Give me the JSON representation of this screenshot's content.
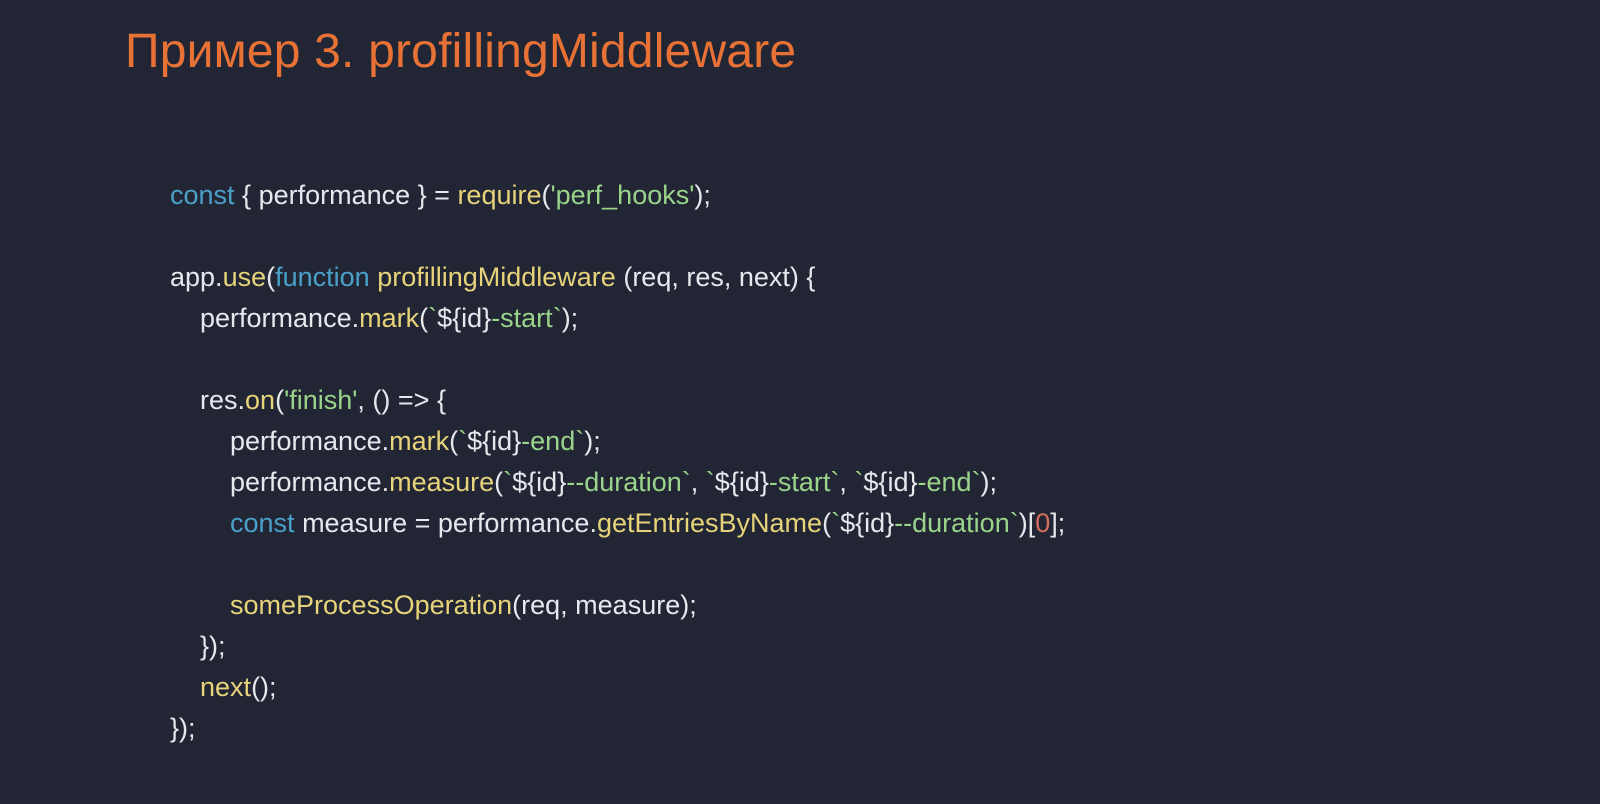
{
  "title": "Пример 3. profillingMiddleware",
  "code": {
    "l1": {
      "kw1": "const",
      "t1": " { performance } = ",
      "fn1": "require",
      "t2": "(",
      "s1": "'perf_hooks'",
      "t3": ");"
    },
    "l2": "",
    "l3": {
      "t1": "app.",
      "fn1": "use",
      "t2": "(",
      "kw1": "function",
      "t3": " ",
      "fn2": "profillingMiddleware",
      "t4": " (req, res, next) {"
    },
    "l4": {
      "pad": "    ",
      "t1": "performance.",
      "fn1": "mark",
      "t2": "(",
      "bt1": "`",
      "i1": "${id}",
      "s1": "-start",
      "bt2": "`",
      "t3": ");"
    },
    "l5": "",
    "l6": {
      "pad": "    ",
      "t1": "res.",
      "fn1": "on",
      "t2": "(",
      "s1": "'finish'",
      "t3": ", () => {"
    },
    "l7": {
      "pad": "        ",
      "t1": "performance.",
      "fn1": "mark",
      "t2": "(",
      "bt1": "`",
      "i1": "${id}",
      "s1": "-end",
      "bt2": "`",
      "t3": ");"
    },
    "l8": {
      "pad": "        ",
      "t1": "performance.",
      "fn1": "measure",
      "t2": "(",
      "bt1": "`",
      "i1": "${id}",
      "s1": "--duration",
      "bt2": "`",
      "t3": ", ",
      "bt3": "`",
      "i2": "${id}",
      "s2": "-start",
      "bt4": "`",
      "t4": ", ",
      "bt5": "`",
      "i3": "${id}",
      "s3": "-end",
      "bt6": "`",
      "t5": ");"
    },
    "l9": {
      "pad": "        ",
      "kw1": "const",
      "t1": " measure = performance.",
      "fn1": "getEntriesByName",
      "t2": "(",
      "bt1": "`",
      "i1": "${id}",
      "s1": "--duration",
      "bt2": "`",
      "t3": ")[",
      "n1": "0",
      "t4": "];"
    },
    "l10": "",
    "l11": {
      "pad": "        ",
      "fn1": "someProcessOperation",
      "t1": "(req, measure);"
    },
    "l12": {
      "pad": "    ",
      "t1": "});"
    },
    "l13": {
      "pad": "    ",
      "fn1": "next",
      "t1": "();"
    },
    "l14": {
      "t1": "});"
    }
  }
}
